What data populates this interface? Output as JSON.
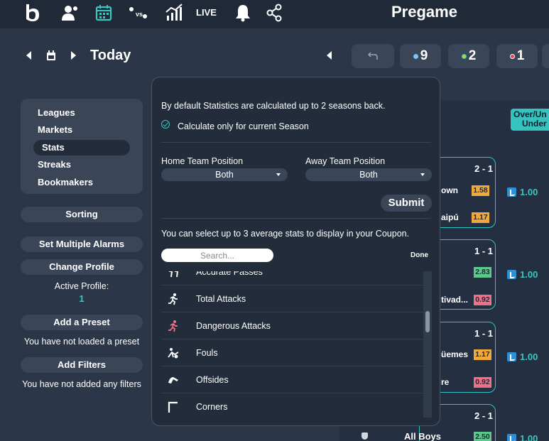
{
  "nav": {
    "live_label": "LIVE",
    "page_title": "Pregame",
    "icons": [
      "logo-icon",
      "user-alarm-icon",
      "calendar-icon",
      "versus-icon",
      "chart-icon",
      "live",
      "bell-icon",
      "share-icon"
    ],
    "accent": "#3cc6c1"
  },
  "date_row": {
    "day_label": "Today",
    "pills": [
      {
        "value": "",
        "icon": "return-icon"
      },
      {
        "value": "9",
        "dot_color": "#7fc3f0"
      },
      {
        "value": "2",
        "dot_color": "#c9c93a"
      },
      {
        "value": "1",
        "dot_color": "#e04050"
      }
    ]
  },
  "sidebar": {
    "menu": [
      "Leagues",
      "Markets",
      "Stats",
      "Streaks",
      "Bookmakers"
    ],
    "active": "Stats",
    "sorting": "Sorting",
    "set_alarms": "Set Multiple Alarms",
    "change_profile": "Change Profile",
    "active_profile_label": "Active Profile:",
    "active_profile_value": "1",
    "add_preset": "Add a Preset",
    "preset_note": "You have not loaded a preset",
    "add_filters": "Add Filters",
    "filters_note": "You have not added any filters"
  },
  "background": {
    "ou_badge": [
      "Over/Un",
      "Under"
    ],
    "cards": [
      {
        "score": "2 - 1",
        "team1": "own",
        "odd1": "1.58",
        "odd1_color": "orange",
        "team2": "aipú",
        "odd2": "1.17",
        "odd2_color": "orange",
        "side": "1.00"
      },
      {
        "score": "1 - 1",
        "team1": "",
        "odd1": "2.83",
        "odd1_color": "green",
        "team2": "tivad...",
        "odd2": "0.92",
        "odd2_color": "red",
        "side": "1.00"
      },
      {
        "score": "1 - 1",
        "team1": "üemes",
        "odd1": "1.17",
        "odd1_color": "orange",
        "team2": "re",
        "odd2": "0.92",
        "odd2_color": "red",
        "side": "1.00"
      },
      {
        "score": "2 - 1",
        "team1": "All Boys",
        "odd1": "2.50",
        "odd1_color": "green",
        "side": "1.00"
      }
    ]
  },
  "popup": {
    "intro": "By default Statistics are calculated up to 2 seasons back.",
    "checkbox_label": "Calculate only for current Season",
    "home_label": "Home Team Position",
    "home_value": "Both",
    "away_label": "Away Team Position",
    "away_value": "Both",
    "submit": "Submit",
    "select_note": "You can select up to 3 average stats to display in your Coupon.",
    "search_placeholder": "Search...",
    "done": "Done",
    "stats": [
      {
        "label": "Accurate Passes",
        "icon": "passes-icon"
      },
      {
        "label": "Total Attacks",
        "icon": "running-icon"
      },
      {
        "label": "Dangerous Attacks",
        "icon": "running-red-icon"
      },
      {
        "label": "Fouls",
        "icon": "foul-icon"
      },
      {
        "label": "Offsides",
        "icon": "offside-icon"
      },
      {
        "label": "Corners",
        "icon": "corner-icon"
      }
    ]
  }
}
